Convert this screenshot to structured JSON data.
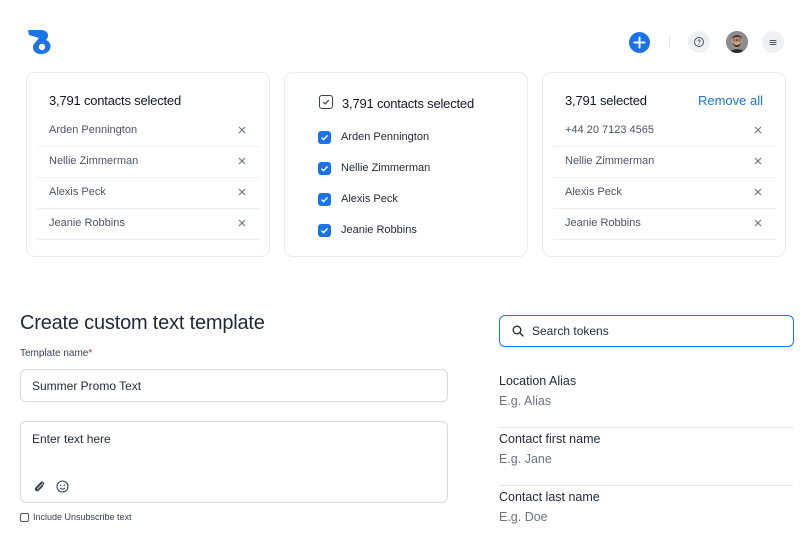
{
  "colors": {
    "accent": "#1a73e8",
    "required": "#e11d48"
  },
  "header": {
    "logo_icon": "brand-logo-icon",
    "add_icon": "plus-icon",
    "help_icon": "help-icon",
    "menu_icon": "hamburger-menu-icon"
  },
  "cards": {
    "simple": {
      "title": "3,791 contacts selected",
      "rows": [
        "Arden Pennington",
        "Nellie Zimmerman",
        "Alexis Peck",
        "Jeanie Robbins"
      ]
    },
    "checkbox": {
      "title": "3,791 contacts selected",
      "rows": [
        "Arden Pennington",
        "Nellie Zimmerman",
        "Alexis Peck",
        "Jeanie Robbins"
      ]
    },
    "removable": {
      "title": "3,791 selected",
      "remove_all": "Remove all",
      "rows": [
        "+44 20 7123 4565",
        "Nellie Zimmerman",
        "Alexis Peck",
        "Jeanie Robbins"
      ]
    }
  },
  "form": {
    "title": "Create custom text template",
    "template_name_label": "Template name",
    "required_mark": "*",
    "template_name_value": "Summer Promo Text",
    "message_placeholder": "Enter text here",
    "unsubscribe_label": "Include Unsubscribe text"
  },
  "tokens": {
    "search_placeholder": "Search tokens",
    "items": [
      {
        "name": "Location Alias",
        "example": "E.g. Alias"
      },
      {
        "name": "Contact first name",
        "example": "E.g. Jane"
      },
      {
        "name": "Contact last name",
        "example": "E.g. Doe"
      }
    ]
  }
}
